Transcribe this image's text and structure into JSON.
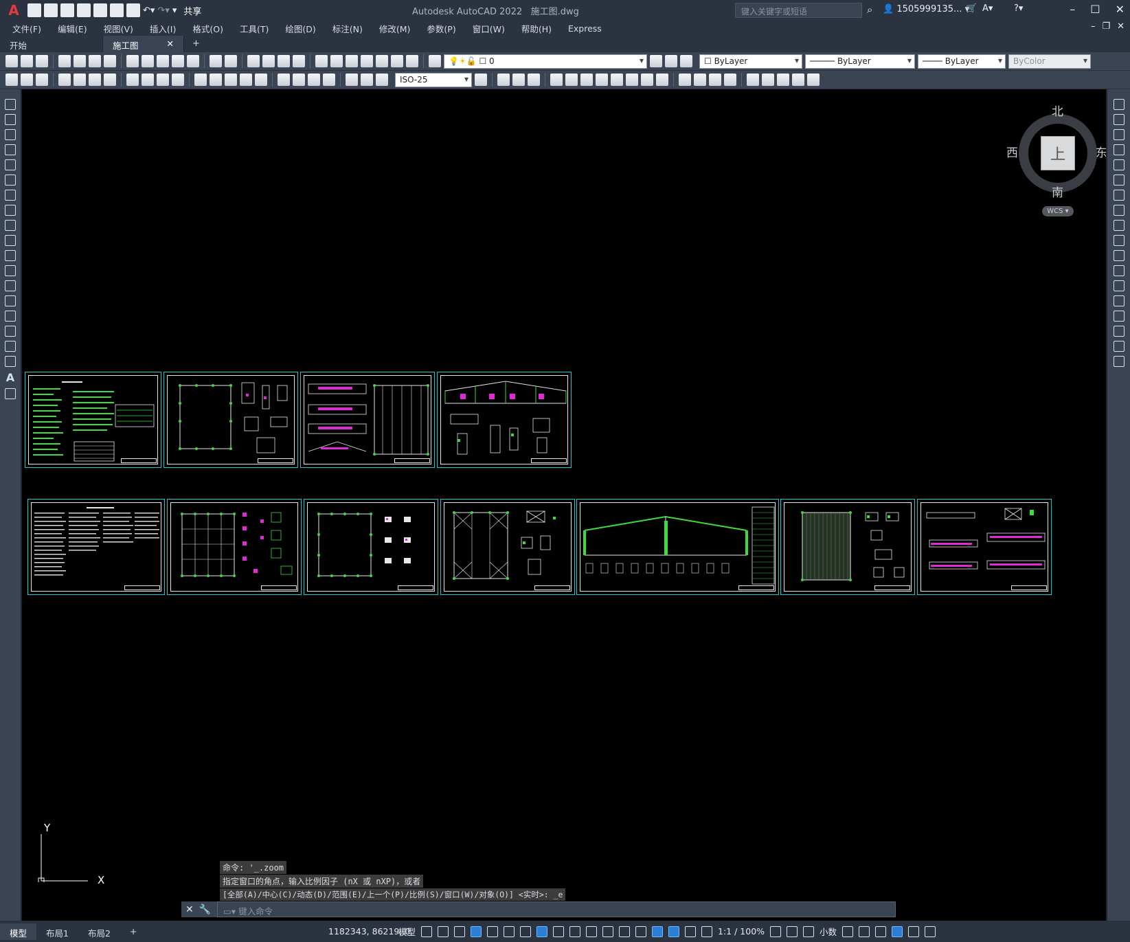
{
  "window": {
    "app_title": "Autodesk AutoCAD 2022",
    "file_title": "施工图.dwg",
    "search_placeholder": "键入关键字或短语",
    "user": "1505999135...",
    "share_label": "共享"
  },
  "menu": [
    "文件(F)",
    "编辑(E)",
    "视图(V)",
    "插入(I)",
    "格式(O)",
    "工具(T)",
    "绘图(D)",
    "标注(N)",
    "修改(M)",
    "参数(P)",
    "窗口(W)",
    "帮助(H)",
    "Express"
  ],
  "tabs": [
    {
      "label": "开始"
    },
    {
      "label": "施工图*"
    }
  ],
  "properties": {
    "layer": "0",
    "color": "ByLayer",
    "linetype": "ByLayer",
    "lineweight": "ByLayer",
    "plotstyle": "ByColor",
    "dimstyle": "ISO-25"
  },
  "viewcube": {
    "top": "上",
    "north": "北",
    "south": "南",
    "east": "东",
    "west": "西",
    "wcs": "WCS"
  },
  "ucs": {
    "x": "X",
    "y": "Y"
  },
  "command": {
    "history": [
      "命令: '_.zoom",
      "指定窗口的角点，输入比例因子 (nX 或 nXP)，或者",
      "[全部(A)/中心(C)/动态(D)/范围(E)/上一个(P)/比例(S)/窗口(W)/对象(O)] <实时>: _e"
    ],
    "placeholder": "键入命令"
  },
  "layout_tabs": [
    "模型",
    "布局1",
    "布局2"
  ],
  "status": {
    "coords": "1182343, 86219, 0",
    "space": "模型",
    "scale": "1:1 / 100%",
    "units": "小数"
  },
  "colors": {
    "sheet_border": "#19c9d2",
    "drawing_green": "#3ddc3d",
    "drawing_magenta": "#e02ad6",
    "canvas": "#000000"
  }
}
